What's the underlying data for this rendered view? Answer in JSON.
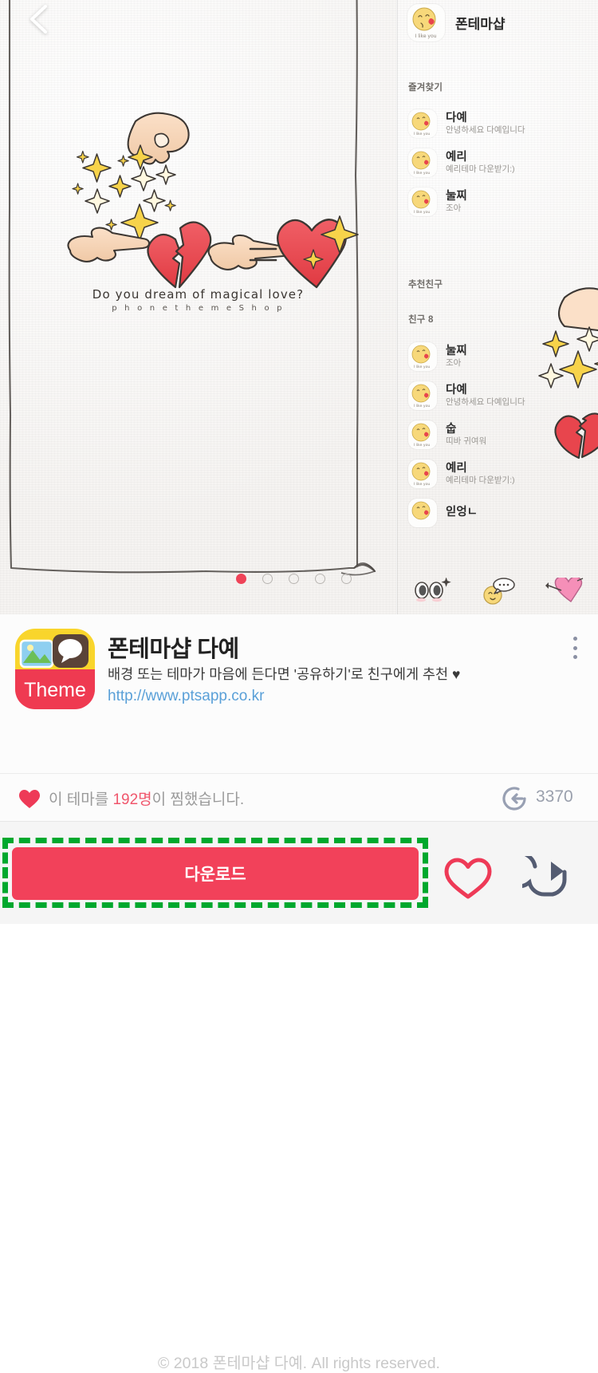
{
  "preview": {
    "back_icon": "back-chevron-icon",
    "illustration": {
      "caption_main": "Do you dream of magical love?",
      "caption_sub": "p h o n e t h e m e S h o p",
      "elements": [
        "sprinkling-hand",
        "sparkles",
        "pointing-hand-right",
        "broken-heart",
        "pointing-hand-right",
        "equals-sign",
        "sparkling-heart"
      ]
    },
    "pagination": {
      "total": 5,
      "active_index": 0
    }
  },
  "messenger": {
    "profile": {
      "name": "폰테마샵",
      "avatar_caption": "I like you"
    },
    "favorites_label": "즐겨찾기",
    "favorites": [
      {
        "name": "다예",
        "status": "안녕하세요 다예입니다"
      },
      {
        "name": "예리",
        "status": "예리테마 다운받기:)"
      },
      {
        "name": "눌찌",
        "status": "조아"
      }
    ],
    "recommended_label": "추천친구",
    "friends_label": "친구 8",
    "friends": [
      {
        "name": "눌찌",
        "status": "조아"
      },
      {
        "name": "다예",
        "status": "안녕하세요 다예입니다"
      },
      {
        "name": "숩",
        "status": "띠바 귀여워"
      },
      {
        "name": "예리",
        "status": "예리테마 다운받기:)"
      },
      {
        "name": "읻엉ㄴ",
        "status": ""
      }
    ],
    "navbar": [
      "eyes-icon",
      "chat-smiley-icon",
      "heart-arrow-icon"
    ]
  },
  "info": {
    "icon_label": "Theme",
    "title": "폰테마샵 다예",
    "description": "배경 또는 테마가 마음에 든다면 '공유하기'로 친구에게 추천 ♥",
    "url": "http://www.ptsapp.co.kr",
    "copyright": "© 2018 폰테마샵 다예. All rights reserved.",
    "menu_icon": "kebab-menu-icon"
  },
  "stats": {
    "heart_icon": "heart-filled-icon",
    "favorite_text_prefix": "이 테마를 ",
    "favorite_count": "192명",
    "favorite_text_suffix": "이 찜했습니다.",
    "download_icon": "download-icon",
    "download_count": "3370"
  },
  "actions": {
    "download_label": "다운로드",
    "like_icon": "heart-outline-icon",
    "share_icon": "share-icon",
    "highlight_color": "#00a82d",
    "download_button_color": "#f2415a"
  }
}
